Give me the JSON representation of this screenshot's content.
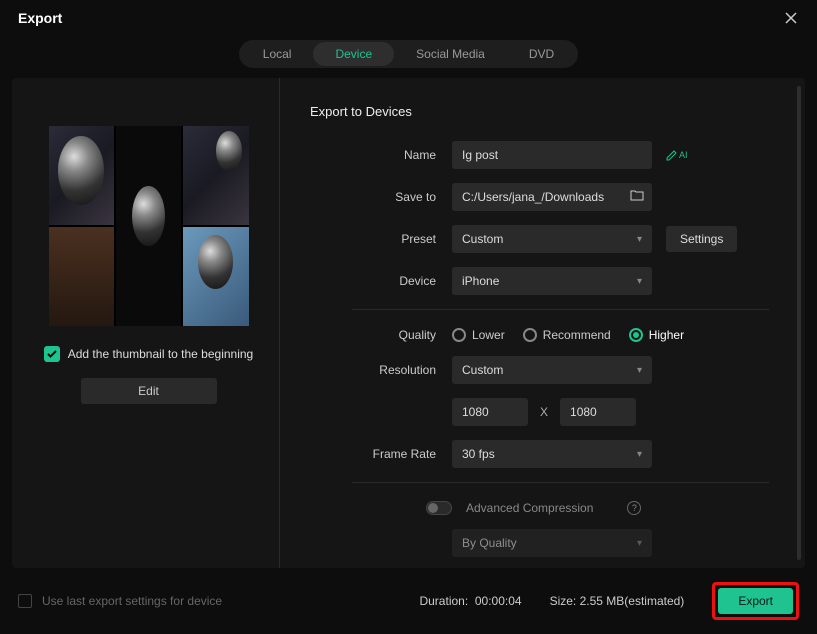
{
  "window": {
    "title": "Export"
  },
  "tabs": {
    "local": "Local",
    "device": "Device",
    "social": "Social Media",
    "dvd": "DVD"
  },
  "section_title": "Export to Devices",
  "labels": {
    "name": "Name",
    "saveto": "Save to",
    "preset": "Preset",
    "device": "Device",
    "quality": "Quality",
    "resolution": "Resolution",
    "framerate": "Frame Rate",
    "advanced": "Advanced Compression"
  },
  "fields": {
    "name": "Ig post",
    "saveto": "C:/Users/jana_/Downloads",
    "preset": "Custom",
    "device": "iPhone",
    "resolution": "Custom",
    "width": "1080",
    "height": "1080",
    "framerate": "30 fps",
    "compression_mode": "By Quality"
  },
  "quality": {
    "lower": "Lower",
    "recommend": "Recommend",
    "higher": "Higher"
  },
  "buttons": {
    "settings": "Settings",
    "edit": "Edit",
    "export": "Export",
    "ai": "AI"
  },
  "thumbnail_opt": "Add the thumbnail to the beginning",
  "res_sep": "X",
  "footer": {
    "use_last": "Use last export settings for device",
    "duration_label": "Duration:",
    "duration_value": "00:00:04",
    "size_label": "Size:",
    "size_value": "2.55 MB(estimated)"
  }
}
